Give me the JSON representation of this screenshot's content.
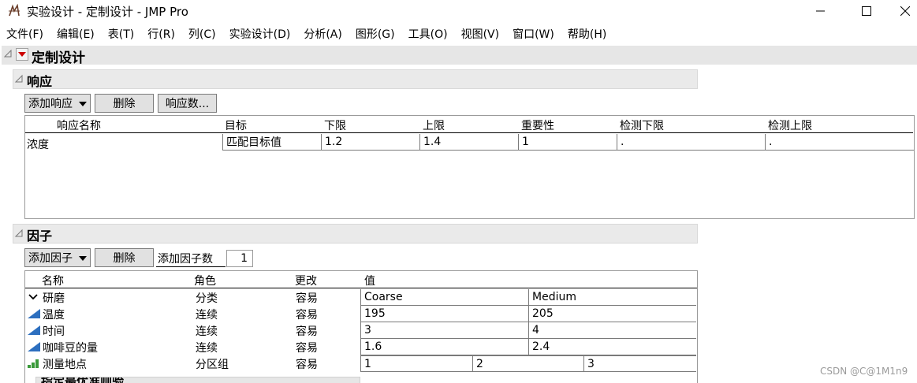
{
  "window": {
    "title": "实验设计 - 定制设计 - JMP Pro",
    "minimize": "—",
    "maximize": "☐",
    "close": "✕"
  },
  "menu": [
    "文件(F)",
    "编辑(E)",
    "表(T)",
    "行(R)",
    "列(C)",
    "实验设计(D)",
    "分析(A)",
    "图形(G)",
    "工具(O)",
    "视图(V)",
    "窗口(W)",
    "帮助(H)"
  ],
  "platform": {
    "title": "定制设计"
  },
  "responses": {
    "title": "响应",
    "add_button": "添加响应",
    "delete_button": "删除",
    "count_button": "响应数...",
    "headers": [
      "响应名称",
      "目标",
      "下限",
      "上限",
      "重要性",
      "检测下限",
      "检测上限"
    ],
    "rows": [
      {
        "name": "浓度",
        "goal": "匹配目标值",
        "lower": "1.2",
        "upper": "1.4",
        "importance": "1",
        "detect_lower": ".",
        "detect_upper": "."
      }
    ]
  },
  "factors": {
    "title": "因子",
    "add_button": "添加因子",
    "delete_button": "删除",
    "add_count_label": "添加因子数",
    "add_count_value": "1",
    "headers": [
      "名称",
      "角色",
      "更改",
      "值"
    ],
    "rows": [
      {
        "icon": "categorical-chevron-icon",
        "name": "研磨",
        "role": "分类",
        "change": "容易",
        "values": [
          "Coarse",
          "Medium"
        ]
      },
      {
        "icon": "continuous-ramp-icon",
        "name": "温度",
        "role": "连续",
        "change": "容易",
        "values": [
          "195",
          "205"
        ]
      },
      {
        "icon": "continuous-ramp-icon",
        "name": "时间",
        "role": "连续",
        "change": "容易",
        "values": [
          "3",
          "4"
        ]
      },
      {
        "icon": "continuous-ramp-icon",
        "name": "咖啡豆的量",
        "role": "连续",
        "change": "容易",
        "values": [
          "1.6",
          "2.4"
        ]
      },
      {
        "icon": "blocking-bars-icon",
        "name": "测量地点",
        "role": "分区组",
        "change": "容易",
        "values": [
          "1",
          "2",
          "3"
        ]
      }
    ]
  },
  "next_section": {
    "title": "指定最优准则验"
  },
  "watermark": "CSDN @C@1M1n9"
}
